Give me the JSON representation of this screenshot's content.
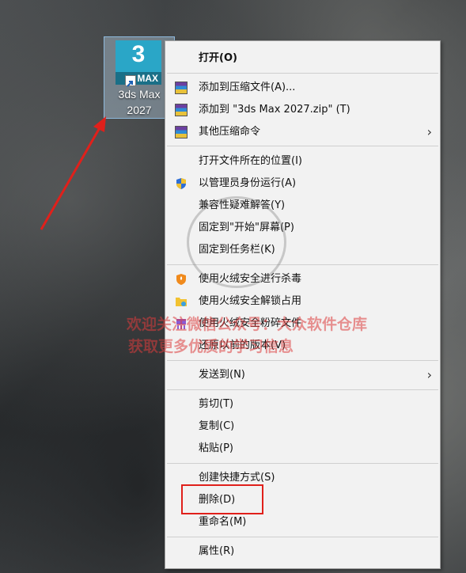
{
  "desktop": {
    "icon": {
      "tile_number": "3",
      "tile_badge": "MAX",
      "label_line1": "3ds Max",
      "label_line2": "2027"
    }
  },
  "menu": {
    "items": [
      {
        "label": "打开(O)",
        "icon": "none",
        "bold": true
      },
      {
        "label": "添加到压缩文件(A)...",
        "icon": "winrar-icon"
      },
      {
        "label": "添加到 \"3ds Max 2027.zip\" (T)",
        "icon": "winrar-icon"
      },
      {
        "label": "其他压缩命令",
        "icon": "winrar-icon",
        "submenu": true
      },
      {
        "label": "打开文件所在的位置(I)",
        "icon": "none"
      },
      {
        "label": "以管理员身份运行(A)",
        "icon": "uac-shield-icon"
      },
      {
        "label": "兼容性疑难解答(Y)",
        "icon": "none"
      },
      {
        "label": "固定到\"开始\"屏幕(P)",
        "icon": "none"
      },
      {
        "label": "固定到任务栏(K)",
        "icon": "none"
      },
      {
        "label": "使用火绒安全进行杀毒",
        "icon": "huorong-shield-icon"
      },
      {
        "label": "使用火绒安全解锁占用",
        "icon": "folder-unlock-icon"
      },
      {
        "label": "使用火绒安全粉碎文件",
        "icon": "shredder-icon"
      },
      {
        "label": "还原以前的版本(V)",
        "icon": "none"
      },
      {
        "label": "发送到(N)",
        "icon": "none",
        "submenu": true
      },
      {
        "label": "剪切(T)",
        "icon": "none"
      },
      {
        "label": "复制(C)",
        "icon": "none"
      },
      {
        "label": "粘贴(P)",
        "icon": "none"
      },
      {
        "label": "创建快捷方式(S)",
        "icon": "none"
      },
      {
        "label": "删除(D)",
        "icon": "none",
        "highlighted_by_annotation": true
      },
      {
        "label": "重命名(M)",
        "icon": "none"
      },
      {
        "label": "属性(R)",
        "icon": "none"
      }
    ],
    "submenu_glyph": "›"
  },
  "watermark": {
    "line1": "欢迎关注微信公众号：大众软件仓库",
    "line2": "获取更多优质的学习信息"
  },
  "colors": {
    "annotation_red": "#e0201b",
    "menu_bg": "#f2f2f2",
    "tile_blue": "#2aa6c7"
  }
}
